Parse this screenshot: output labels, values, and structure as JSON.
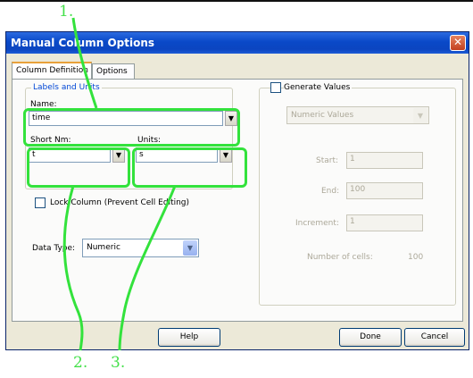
{
  "annotations": {
    "label_1": "1.",
    "label_2": "2.",
    "label_3": "3."
  },
  "window": {
    "title": "Manual Column Options",
    "close_symbol": "✕",
    "tabs": [
      "Column Definition",
      "Options"
    ]
  },
  "labels_group": {
    "legend": "Labels and Units",
    "name_label": "Name:",
    "name_value": "time",
    "short_label": "Short Nm:",
    "short_value": "t",
    "units_label": "Units:",
    "units_value": "s",
    "dropdown_symbol": "▼"
  },
  "lock": {
    "label": "Lock Column (Prevent Cell Editing)"
  },
  "data_type": {
    "label": "Data Type:",
    "value": "Numeric"
  },
  "generate": {
    "label": "Generate Values",
    "method": "Numeric Values",
    "start_label": "Start:",
    "start_value": "1",
    "end_label": "End:",
    "end_value": "100",
    "increment_label": "Increment:",
    "increment_value": "1",
    "cells_label": "Number of cells:",
    "cells_value": "100"
  },
  "buttons": {
    "help": "Help",
    "done": "Done",
    "cancel": "Cancel"
  },
  "colors": {
    "highlight": "#33e23c",
    "title_bar": "#0a49c8",
    "legend_text": "#0046d5"
  },
  "icons": {
    "close": "close-icon",
    "dropdown": "chevron-down-icon"
  }
}
